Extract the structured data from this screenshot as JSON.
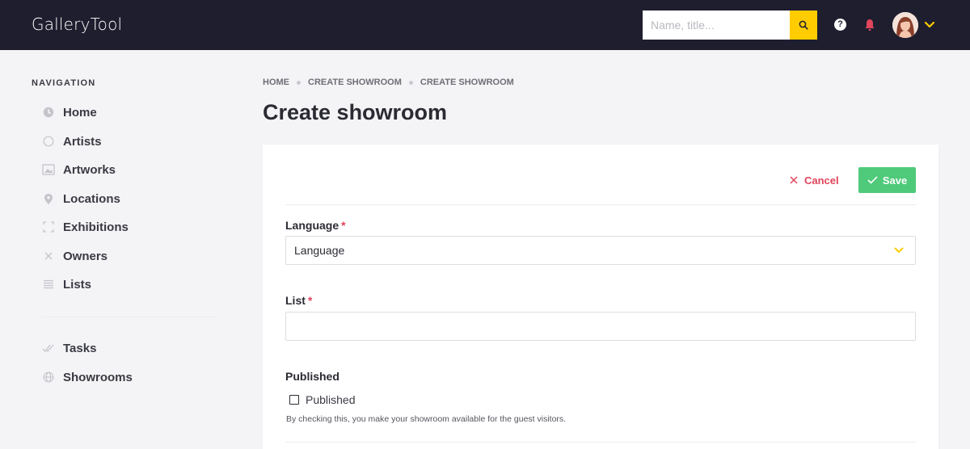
{
  "header": {
    "brand": "GalleryTool",
    "search_placeholder": "Name, title...",
    "accent_color": "#ffcc00",
    "bar_color": "#1e1e2f",
    "help_icon_glyph": "?"
  },
  "sidebar": {
    "title": "NAVIGATION",
    "items": [
      {
        "label": "Home",
        "icon": "clock-icon"
      },
      {
        "label": "Artists",
        "icon": "circle-icon"
      },
      {
        "label": "Artworks",
        "icon": "image-icon"
      },
      {
        "label": "Locations",
        "icon": "map-pin-icon"
      },
      {
        "label": "Exhibitions",
        "icon": "frame-icon"
      },
      {
        "label": "Owners",
        "icon": "x-icon"
      },
      {
        "label": "Lists",
        "icon": "list-icon"
      }
    ],
    "secondary_items": [
      {
        "label": "Tasks",
        "icon": "double-check-icon"
      },
      {
        "label": "Showrooms",
        "icon": "globe-icon"
      }
    ]
  },
  "breadcrumb": [
    "HOME",
    "CREATE SHOWROOM",
    "CREATE SHOWROOM"
  ],
  "page_title": "Create showroom",
  "form": {
    "cancel_label": "Cancel",
    "save_label": "Save",
    "language_label": "Language",
    "language_value": "Language",
    "list_label": "List",
    "list_value": "",
    "required_mark": "*",
    "published_label": "Published",
    "published_checkbox_label": "Published",
    "published_checked": false,
    "published_help": "By checking this, you make your showroom available for the guest visitors.",
    "cancel_color": "#e0455b",
    "save_color": "#4fca7a"
  }
}
